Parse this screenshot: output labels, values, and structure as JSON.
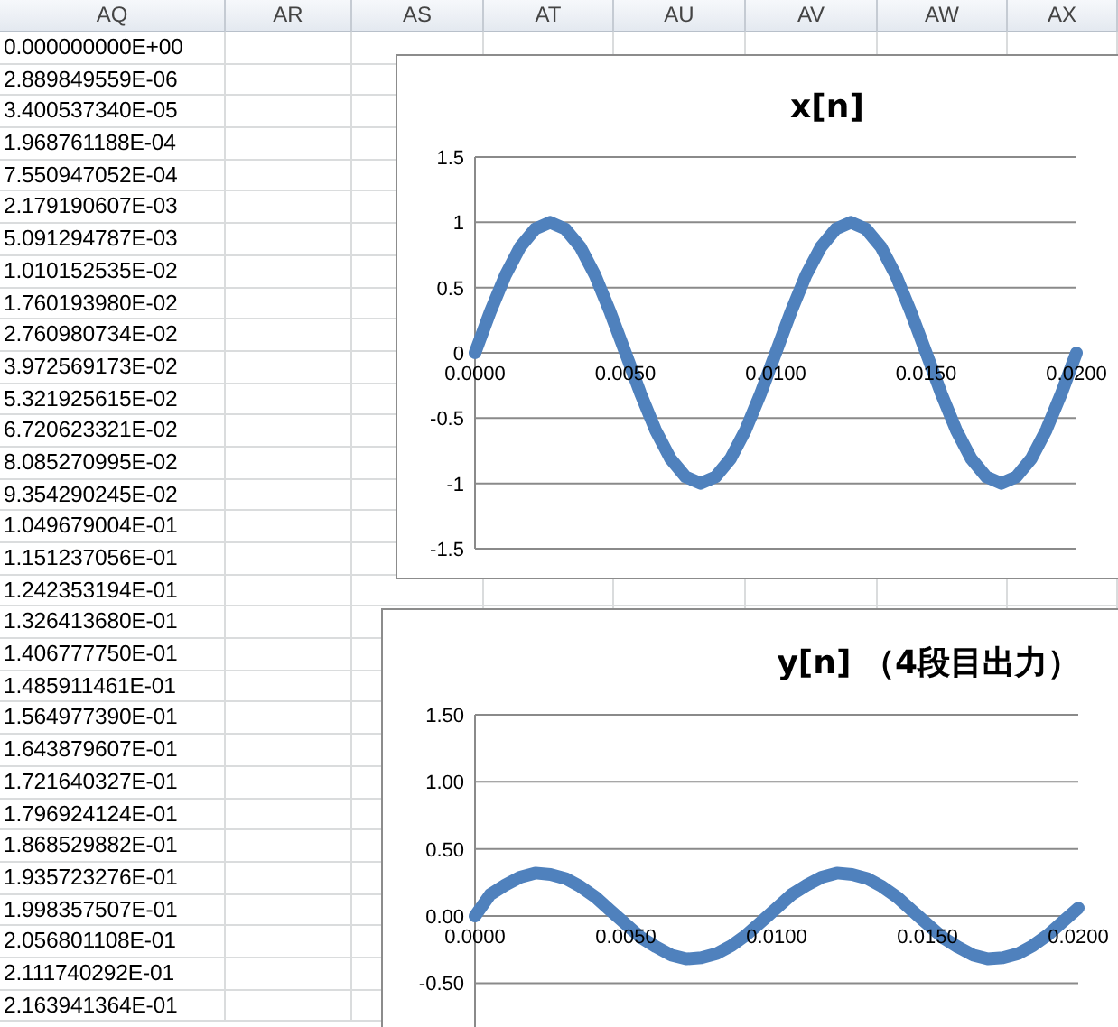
{
  "sheet": {
    "columns": [
      "AQ",
      "AR",
      "AS",
      "AT",
      "AU",
      "AV",
      "AW",
      "AX"
    ],
    "column_aq_values": [
      "0.000000000E+00",
      "2.889849559E-06",
      "3.400537340E-05",
      "1.968761188E-04",
      "7.550947052E-04",
      "2.179190607E-03",
      "5.091294787E-03",
      "1.010152535E-02",
      "1.760193980E-02",
      "2.760980734E-02",
      "3.972569173E-02",
      "5.321925615E-02",
      "6.720623321E-02",
      "8.085270995E-02",
      "9.354290245E-02",
      "1.049679004E-01",
      "1.151237056E-01",
      "1.242353194E-01",
      "1.326413680E-01",
      "1.406777750E-01",
      "1.485911461E-01",
      "1.564977390E-01",
      "1.643879607E-01",
      "1.721640327E-01",
      "1.796924124E-01",
      "1.868529882E-01",
      "1.935723276E-01",
      "1.998357507E-01",
      "2.056801108E-01",
      "2.111740292E-01",
      "2.163941364E-01"
    ]
  },
  "charts": [
    {
      "chart_data": {
        "type": "line",
        "title": "x[n]",
        "x": [
          0,
          0.0005,
          0.001,
          0.0015,
          0.002,
          0.0025,
          0.003,
          0.0035,
          0.004,
          0.0045,
          0.005,
          0.0055,
          0.006,
          0.0065,
          0.007,
          0.0075,
          0.008,
          0.0085,
          0.009,
          0.0095,
          0.01,
          0.0105,
          0.011,
          0.0115,
          0.012,
          0.0125,
          0.013,
          0.0135,
          0.014,
          0.0145,
          0.015,
          0.0155,
          0.016,
          0.0165,
          0.017,
          0.0175,
          0.018,
          0.0185,
          0.019,
          0.0195,
          0.02
        ],
        "series": [
          {
            "color": "#4f81bd",
            "values": [
              0,
              0.31,
              0.59,
              0.81,
              0.95,
              1,
              0.95,
              0.81,
              0.59,
              0.31,
              0,
              -0.31,
              -0.59,
              -0.81,
              -0.95,
              -1,
              -0.95,
              -0.81,
              -0.59,
              -0.31,
              0,
              0.31,
              0.59,
              0.81,
              0.95,
              1,
              0.95,
              0.81,
              0.59,
              0.31,
              0,
              -0.31,
              -0.59,
              -0.81,
              -0.95,
              -1,
              -0.95,
              -0.81,
              -0.59,
              -0.31,
              0
            ]
          }
        ],
        "xlim": [
          0,
          0.02
        ],
        "ylim": [
          -1.5,
          1.5
        ],
        "grid": true,
        "xticks": [
          {
            "value": 0,
            "label": "0.0000"
          },
          {
            "value": 0.005,
            "label": "0.0050"
          },
          {
            "value": 0.01,
            "label": "0.0100"
          },
          {
            "value": 0.015,
            "label": "0.0150"
          },
          {
            "value": 0.02,
            "label": "0.0200"
          }
        ],
        "yticks": [
          {
            "value": 1.5,
            "label": "1.5"
          },
          {
            "value": 1,
            "label": "1"
          },
          {
            "value": 0.5,
            "label": "0.5"
          },
          {
            "value": 0,
            "label": "0"
          },
          {
            "value": -0.5,
            "label": "-0.5"
          },
          {
            "value": -1,
            "label": "-1"
          },
          {
            "value": -1.5,
            "label": "-1.5"
          }
        ]
      }
    },
    {
      "chart_data": {
        "type": "line",
        "title": "y[n] （4段目出力）",
        "x": [
          0,
          0.0005,
          0.001,
          0.0015,
          0.002,
          0.0025,
          0.003,
          0.0035,
          0.004,
          0.0045,
          0.005,
          0.0055,
          0.006,
          0.0065,
          0.007,
          0.0075,
          0.008,
          0.0085,
          0.009,
          0.0095,
          0.01,
          0.0105,
          0.011,
          0.0115,
          0.012,
          0.0125,
          0.013,
          0.0135,
          0.014,
          0.0145,
          0.015,
          0.0155,
          0.016,
          0.0165,
          0.017,
          0.0175,
          0.018,
          0.0185,
          0.019,
          0.0195,
          0.02
        ],
        "series": [
          {
            "color": "#4f81bd",
            "values": [
              0,
              0.16,
              0.23,
              0.29,
              0.32,
              0.31,
              0.28,
              0.22,
              0.14,
              0.04,
              -0.06,
              -0.16,
              -0.23,
              -0.29,
              -0.32,
              -0.31,
              -0.28,
              -0.22,
              -0.14,
              -0.04,
              0.06,
              0.16,
              0.23,
              0.29,
              0.32,
              0.31,
              0.28,
              0.22,
              0.14,
              0.04,
              -0.06,
              -0.16,
              -0.23,
              -0.29,
              -0.32,
              -0.31,
              -0.28,
              -0.22,
              -0.14,
              -0.04,
              0.06
            ]
          }
        ],
        "xlim": [
          0,
          0.02
        ],
        "ylim": [
          -0.84,
          1.5
        ],
        "grid": true,
        "xticks": [
          {
            "value": 0,
            "label": "0.0000"
          },
          {
            "value": 0.005,
            "label": "0.0050"
          },
          {
            "value": 0.01,
            "label": "0.0100"
          },
          {
            "value": 0.015,
            "label": "0.0150"
          },
          {
            "value": 0.02,
            "label": "0.0200"
          }
        ],
        "yticks": [
          {
            "value": 1.5,
            "label": "1.50"
          },
          {
            "value": 1,
            "label": "1.00"
          },
          {
            "value": 0.5,
            "label": "0.50"
          },
          {
            "value": 0,
            "label": "0.00"
          },
          {
            "value": -0.5,
            "label": "-0.50"
          }
        ]
      }
    }
  ]
}
